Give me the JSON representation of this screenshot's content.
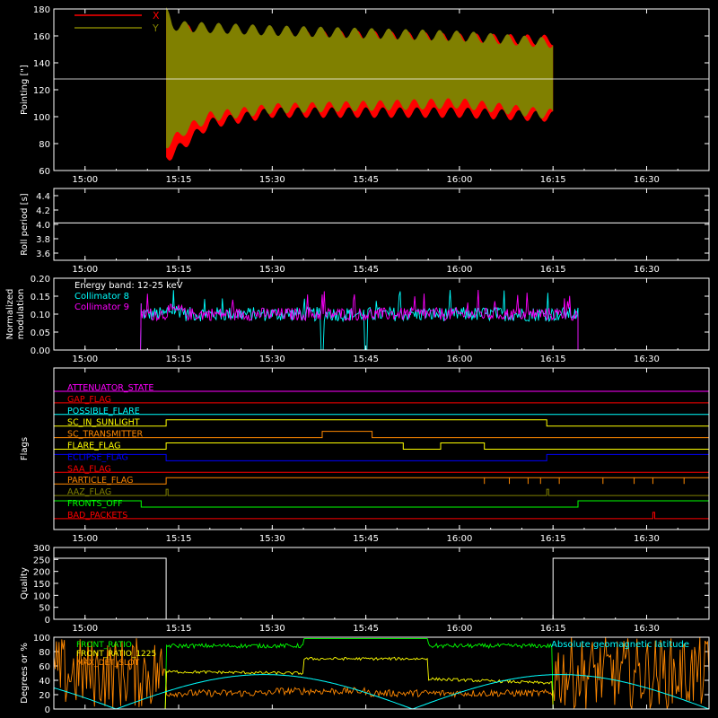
{
  "chart_data": [
    {
      "type": "line",
      "id": "pointing",
      "ylabel": "Pointing [\"]",
      "ylim": [
        60,
        180
      ],
      "yticks": [
        60,
        80,
        100,
        120,
        140,
        160,
        180
      ],
      "xlim_minutes": [
        895,
        1000
      ],
      "xticks": [
        "15:00",
        "15:15",
        "15:30",
        "15:45",
        "16:00",
        "16:15",
        "16:30"
      ],
      "legend": "top-left",
      "reference_line": 128,
      "series": [
        {
          "name": "X",
          "color": "#ff0000",
          "start": "15:13",
          "end": "16:15",
          "envelope_upper": [
            [
              "15:13",
              178
            ],
            [
              "15:14",
              160
            ],
            [
              "15:16",
              165
            ],
            [
              "15:20",
              162
            ],
            [
              "15:30",
              160
            ],
            [
              "15:45",
              160
            ],
            [
              "16:00",
              158
            ],
            [
              "16:14",
              157
            ]
          ],
          "envelope_lower": [
            [
              "15:13",
              70
            ],
            [
              "15:14",
              72
            ],
            [
              "15:16",
              80
            ],
            [
              "15:20",
              95
            ],
            [
              "15:30",
              103
            ],
            [
              "15:45",
              103
            ],
            [
              "16:00",
              103
            ],
            [
              "16:14",
              100
            ]
          ]
        },
        {
          "name": "Y",
          "color": "#808000",
          "start": "15:13",
          "end": "16:15",
          "envelope_upper": [
            [
              "15:13",
              178
            ],
            [
              "15:14",
              168
            ],
            [
              "15:16",
              167
            ],
            [
              "15:20",
              166
            ],
            [
              "15:30",
              164
            ],
            [
              "15:45",
              162
            ],
            [
              "16:00",
              160
            ],
            [
              "16:14",
              155
            ]
          ],
          "envelope_lower": [
            [
              "15:13",
              80
            ],
            [
              "15:14",
              82
            ],
            [
              "15:16",
              90
            ],
            [
              "15:20",
              100
            ],
            [
              "15:30",
              106
            ],
            [
              "15:45",
              108
            ],
            [
              "16:00",
              110
            ],
            [
              "16:14",
              102
            ]
          ]
        }
      ]
    },
    {
      "type": "line",
      "id": "roll",
      "ylabel": "Roll period [s]",
      "ylim": [
        3.5,
        4.5
      ],
      "yticks": [
        3.6,
        3.8,
        4.0,
        4.2,
        4.4
      ],
      "xticks": [
        "15:00",
        "15:15",
        "15:30",
        "15:45",
        "16:00",
        "16:15",
        "16:30"
      ],
      "series": [
        {
          "name": "",
          "color": "#ffffff",
          "constant": 4.02
        }
      ]
    },
    {
      "type": "line",
      "id": "modulation",
      "ylabel": "Normalized modulation",
      "ylim": [
        0.0,
        0.2
      ],
      "yticks": [
        0.0,
        0.05,
        0.1,
        0.15,
        0.2
      ],
      "xticks": [
        "15:00",
        "15:15",
        "15:30",
        "15:45",
        "16:00",
        "16:15",
        "16:30"
      ],
      "annotation": "Energy band: 12-25 keV",
      "series": [
        {
          "name": "Collimator 8",
          "color": "#00ffff",
          "start": "15:09",
          "end": "16:19",
          "mean": 0.1,
          "noise": 0.02,
          "dropouts": [
            "15:38",
            "15:45"
          ]
        },
        {
          "name": "Collimator 9",
          "color": "#ff00ff",
          "start": "15:09",
          "end": "16:19",
          "mean": 0.1,
          "noise": 0.018
        }
      ]
    },
    {
      "type": "line",
      "id": "flags",
      "ylabel": "Flags",
      "xticks": [
        "15:00",
        "15:15",
        "15:30",
        "15:45",
        "16:00",
        "16:15",
        "16:30"
      ],
      "flags": [
        {
          "name": "ATTENUATOR_STATE",
          "color": "#ff00ff",
          "high": []
        },
        {
          "name": "GAP_FLAG",
          "color": "#ff0000",
          "high": []
        },
        {
          "name": "POSSIBLE_FLARE",
          "color": "#00ffff",
          "high": []
        },
        {
          "name": "SC_IN_SUNLIGHT",
          "color": "#ffff00",
          "high": [
            [
              "15:13",
              "16:14"
            ]
          ]
        },
        {
          "name": "SC_TRANSMITTER",
          "color": "#ff8800",
          "high": [
            [
              "15:38",
              "15:46"
            ]
          ]
        },
        {
          "name": "FLARE_FLAG",
          "color": "#ffff00",
          "high": [
            [
              "15:13",
              "15:51"
            ],
            [
              "15:57",
              "16:04"
            ]
          ]
        },
        {
          "name": "ECLIPSE_FLAG",
          "color": "#0000ff",
          "high": [
            [
              "00:00",
              "15:13"
            ],
            [
              "16:14",
              "23:59"
            ]
          ]
        },
        {
          "name": "SAA_FLAG",
          "color": "#ff0000",
          "high": []
        },
        {
          "name": "PARTICLE_FLAG",
          "color": "#ff8800",
          "high": [
            [
              "15:13",
              "16:55"
            ]
          ]
        },
        {
          "name": "AAZ_FLAG",
          "color": "#808000",
          "high": [
            [
              "15:13",
              "15:13"
            ],
            [
              "16:14",
              "16:14"
            ]
          ]
        },
        {
          "name": "FRONTS_OFF",
          "color": "#00ff00",
          "high": [
            [
              "00:00",
              "15:09"
            ],
            [
              "16:19",
              "23:59"
            ]
          ]
        },
        {
          "name": "BAD_PACKETS",
          "color": "#ff0000",
          "high": [
            [
              "16:31",
              "16:31"
            ]
          ]
        }
      ]
    },
    {
      "type": "line",
      "id": "quality",
      "ylabel": "Quality",
      "ylim": [
        0,
        300
      ],
      "yticks": [
        0,
        50,
        100,
        150,
        200,
        250,
        300
      ],
      "xticks": [
        "15:00",
        "15:15",
        "15:30",
        "15:45",
        "16:00",
        "16:15",
        "16:30"
      ],
      "series": [
        {
          "name": "",
          "color": "#ffffff",
          "segments": [
            [
              "00:00",
              "15:13",
              255
            ],
            [
              "15:13",
              "16:15",
              0
            ],
            [
              "16:15",
              "23:59",
              255
            ]
          ]
        }
      ]
    },
    {
      "type": "line",
      "id": "rates",
      "ylabel": "Degrees or %",
      "ylim": [
        0,
        100
      ],
      "yticks": [
        0,
        20,
        40,
        60,
        80,
        100
      ],
      "legend": "top-left",
      "series": [
        {
          "name": "FRONT_RATIO",
          "color": "#00ff00"
        },
        {
          "name": "FRONT_RATIO_1225",
          "color": "#ffff00"
        },
        {
          "name": "MAX_DET_SLOT",
          "color": "#ff8800"
        },
        {
          "name": "Absolute geomagnetic latitude",
          "color": "#00ffff"
        }
      ]
    }
  ]
}
